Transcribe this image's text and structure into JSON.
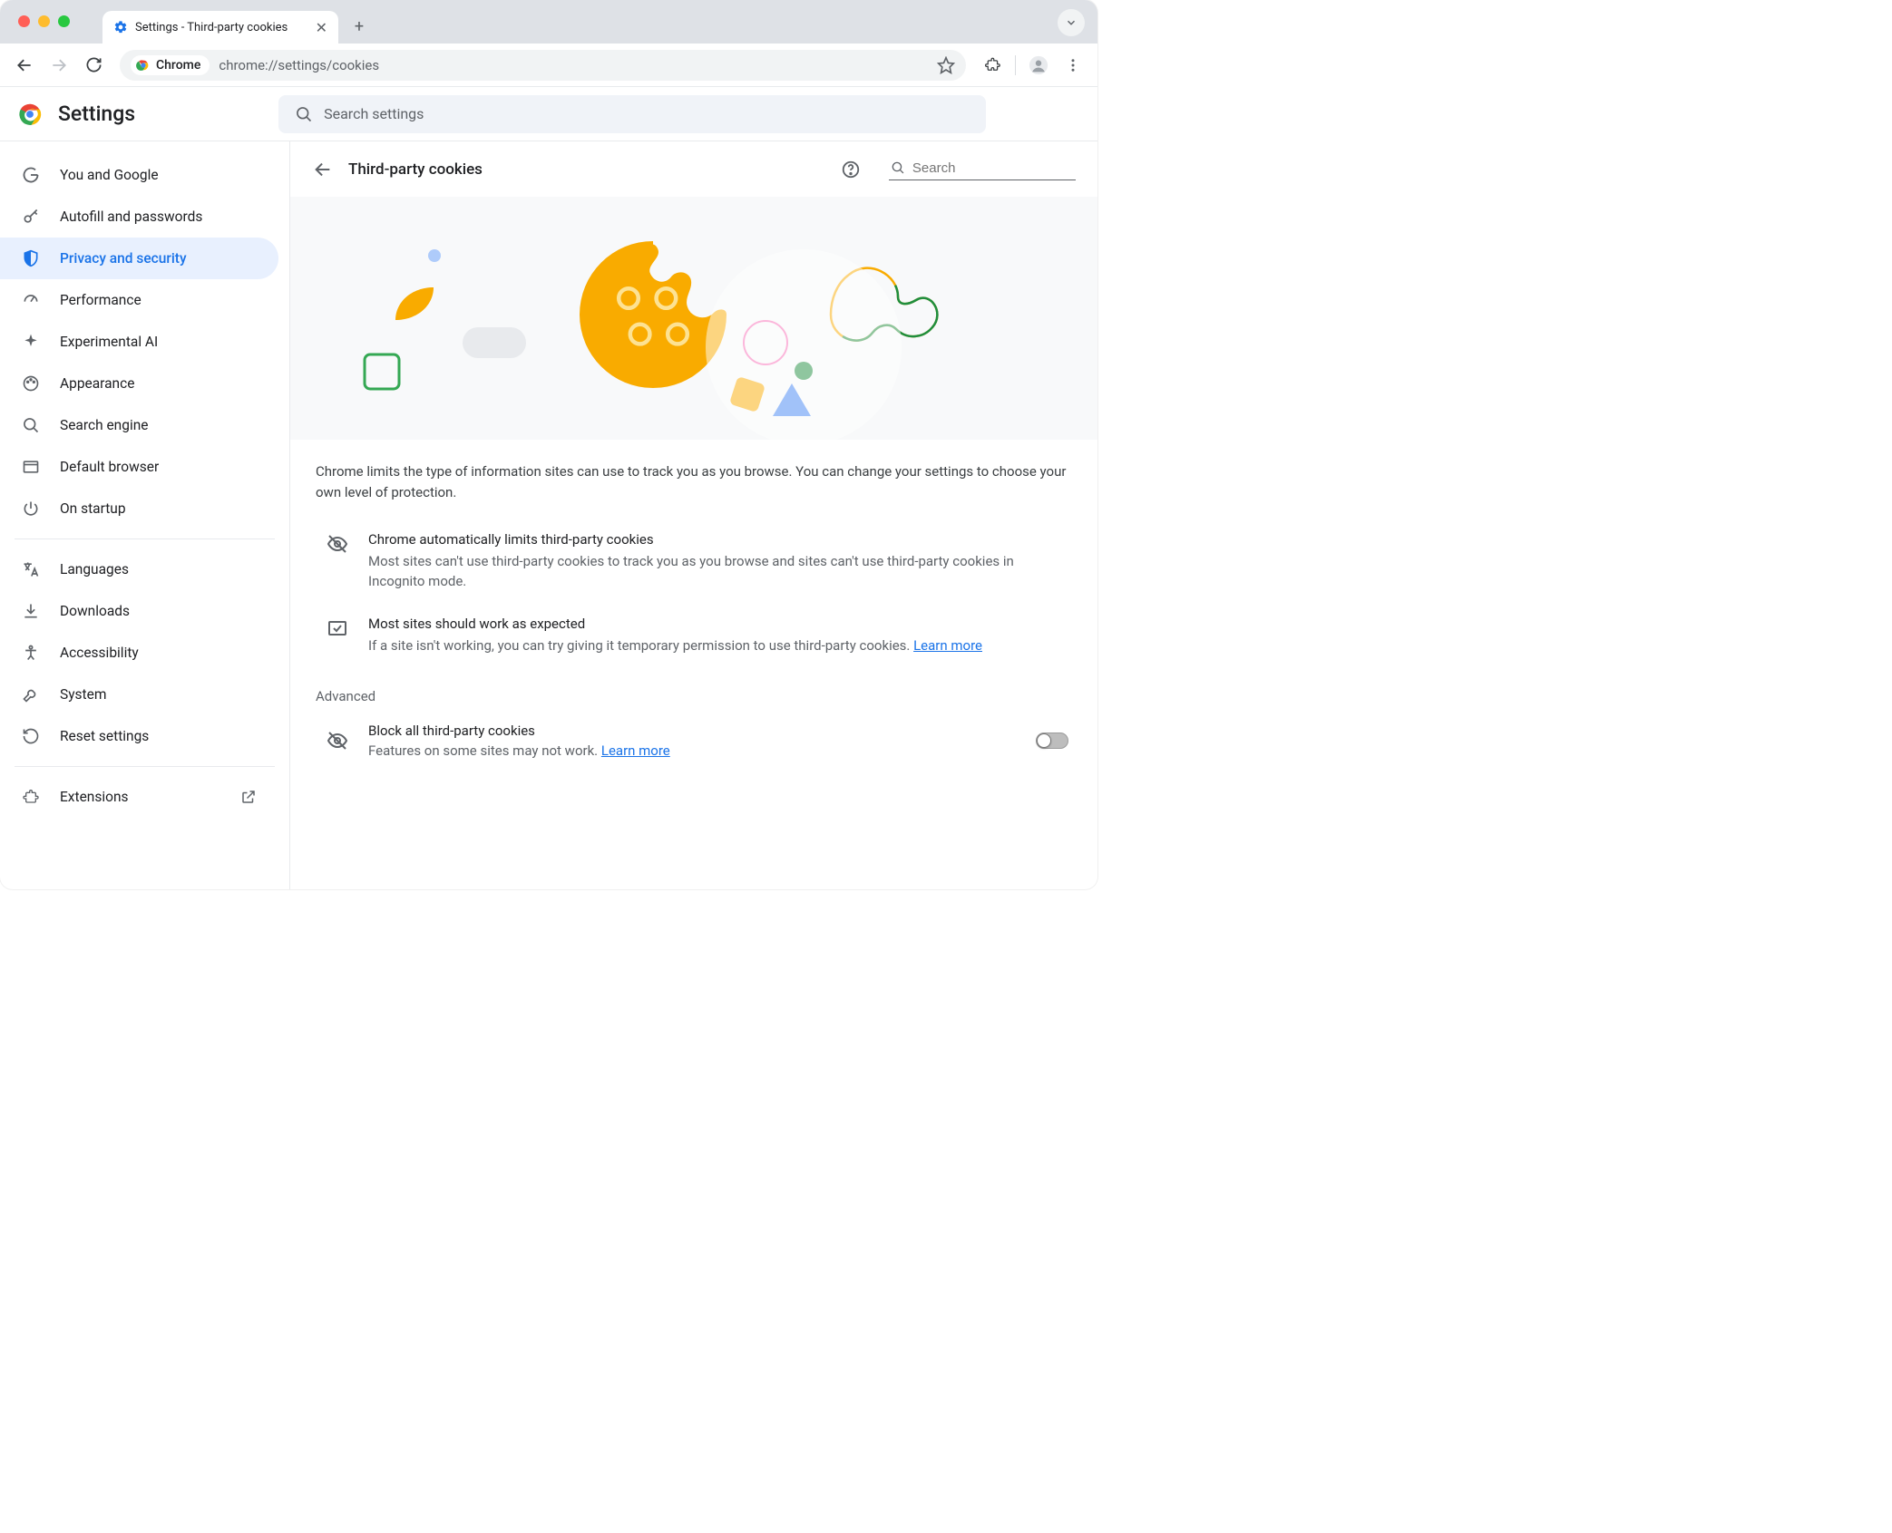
{
  "tab": {
    "title": "Settings - Third-party cookies"
  },
  "omnibox": {
    "chip_label": "Chrome",
    "url": "chrome://settings/cookies"
  },
  "header": {
    "app_title": "Settings",
    "search_placeholder": "Search settings"
  },
  "sidebar": {
    "items": [
      {
        "label": "You and Google"
      },
      {
        "label": "Autofill and passwords"
      },
      {
        "label": "Privacy and security"
      },
      {
        "label": "Performance"
      },
      {
        "label": "Experimental AI"
      },
      {
        "label": "Appearance"
      },
      {
        "label": "Search engine"
      },
      {
        "label": "Default browser"
      },
      {
        "label": "On startup"
      }
    ],
    "items2": [
      {
        "label": "Languages"
      },
      {
        "label": "Downloads"
      },
      {
        "label": "Accessibility"
      },
      {
        "label": "System"
      },
      {
        "label": "Reset settings"
      }
    ],
    "extensions_label": "Extensions"
  },
  "page": {
    "title": "Third-party cookies",
    "search_placeholder": "Search",
    "intro": "Chrome limits the type of information sites can use to track you as you browse. You can change your settings to choose your own level of protection.",
    "info1_title": "Chrome automatically limits third-party cookies",
    "info1_desc": "Most sites can't use third-party cookies to track you as you browse and sites can't use third-party cookies in Incognito mode.",
    "info2_title": "Most sites should work as expected",
    "info2_desc": "If a site isn't working, you can try giving it temporary permission to use third-party cookies. ",
    "learn_more": "Learn more",
    "advanced_label": "Advanced",
    "block_title": "Block all third-party cookies",
    "block_desc": "Features on some sites may not work. "
  }
}
